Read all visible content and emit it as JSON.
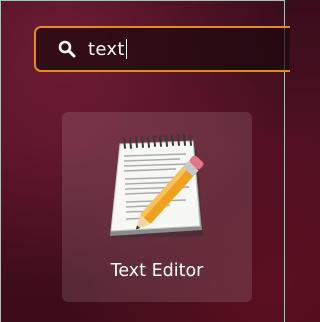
{
  "search": {
    "value": "text"
  },
  "results": [
    {
      "label": "Text Editor",
      "icon": "text-editor-icon"
    }
  ],
  "colors": {
    "focus_border": "#e08a2c",
    "background": "#4a1020"
  }
}
